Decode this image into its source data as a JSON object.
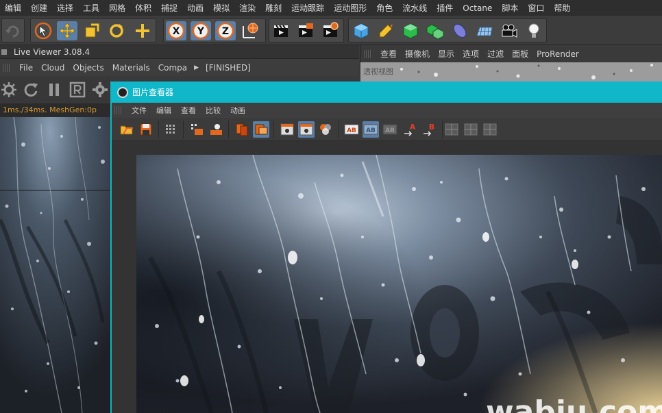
{
  "menubar": {
    "items": [
      "编辑",
      "创建",
      "选择",
      "工具",
      "网格",
      "体积",
      "捕捉",
      "动画",
      "模拟",
      "渲染",
      "雕刻",
      "运动跟踪",
      "运动图形",
      "角色",
      "流水线",
      "插件",
      "Octane",
      "脚本",
      "窗口",
      "帮助"
    ]
  },
  "toolbar": {
    "axis_x": "X",
    "axis_y": "Y",
    "axis_z": "Z"
  },
  "live_viewer": {
    "title": "Live Viewer 3.08.4",
    "menu": [
      "File",
      "Cloud",
      "Objects",
      "Materials",
      "Compa"
    ],
    "status_label": "[FINISHED]",
    "stats_text": "1ms./34ms. MeshGen:0p"
  },
  "viewport": {
    "menu": [
      "查看",
      "摄像机",
      "显示",
      "选项",
      "过滤",
      "面板",
      "ProRender"
    ],
    "label": "透视视图"
  },
  "picture_viewer": {
    "title": "图片查看器",
    "menu": [
      "文件",
      "编辑",
      "查看",
      "比较",
      "动画"
    ],
    "tool_ab": "AB",
    "tool_a": "A",
    "tool_b": "B",
    "watermark": "wabiu.com"
  },
  "colors": {
    "accent": "#0fb7c8",
    "selected": "#5b7fa6",
    "status": "#d79a2f"
  }
}
